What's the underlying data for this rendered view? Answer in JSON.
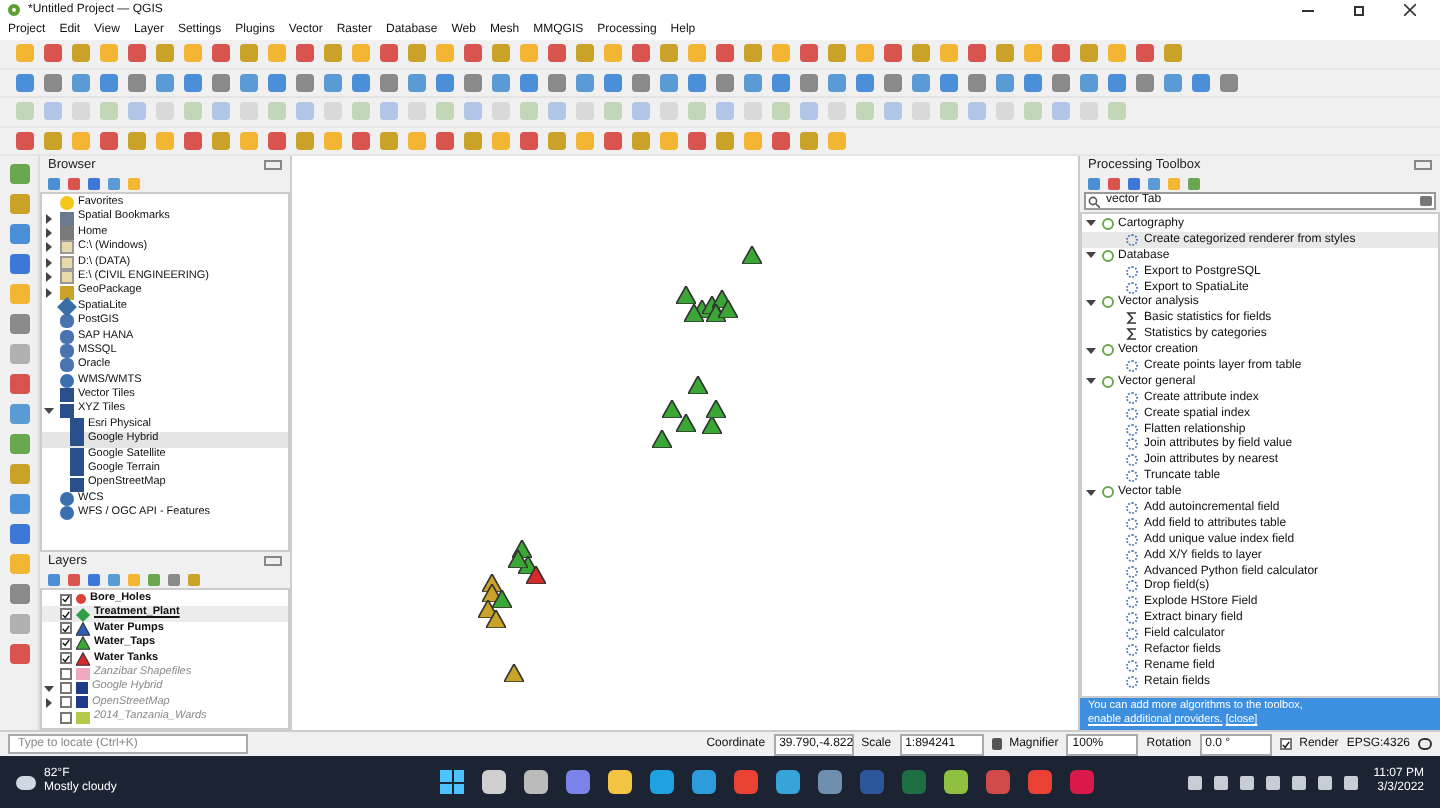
{
  "window": {
    "title": "*Untitled Project — QGIS"
  },
  "menu": [
    "Project",
    "Edit",
    "View",
    "Layer",
    "Settings",
    "Plugins",
    "Vector",
    "Raster",
    "Database",
    "Web",
    "Mesh",
    "MMQGIS",
    "Processing",
    "Help"
  ],
  "browser": {
    "title": "Browser",
    "items": [
      {
        "label": "Favorites"
      },
      {
        "label": "Spatial Bookmarks",
        "expandable": true
      },
      {
        "label": "Home",
        "expandable": true
      },
      {
        "label": "C:\\ (Windows)",
        "expandable": true
      },
      {
        "label": "D:\\ (DATA)",
        "expandable": true
      },
      {
        "label": "E:\\ (CIVIL ENGINEERING)",
        "expandable": true
      },
      {
        "label": "GeoPackage",
        "expandable": true
      },
      {
        "label": "SpatiaLite"
      },
      {
        "label": "PostGIS"
      },
      {
        "label": "SAP HANA"
      },
      {
        "label": "MSSQL"
      },
      {
        "label": "Oracle"
      },
      {
        "label": "WMS/WMTS"
      },
      {
        "label": "Vector Tiles"
      },
      {
        "label": "XYZ Tiles",
        "expandable": true,
        "expanded": true,
        "children": [
          {
            "label": "Esri Physical",
            "selected": false
          },
          {
            "label": "Google Hybrid",
            "selected": true
          },
          {
            "label": "Google Satellite",
            "selected": false
          },
          {
            "label": "Google Terrain",
            "selected": false
          },
          {
            "label": "OpenStreetMap",
            "selected": false
          }
        ]
      },
      {
        "label": "WCS"
      },
      {
        "label": "WFS / OGC API - Features"
      }
    ]
  },
  "layers": {
    "title": "Layers",
    "items": [
      {
        "name": "Bore_Holes",
        "checked": true,
        "selected": false,
        "kind": "dot",
        "color": "#e0403a"
      },
      {
        "name": "Treatment_Plant",
        "checked": true,
        "selected": true,
        "kind": "diamond",
        "color": "#2f9e44"
      },
      {
        "name": "Water Pumps",
        "checked": true,
        "selected": false,
        "kind": "triangle",
        "color": "#2c5fb8"
      },
      {
        "name": "Water_Taps",
        "checked": true,
        "selected": false,
        "kind": "triangle",
        "color": "#3aa635"
      },
      {
        "name": "Water Tanks",
        "checked": true,
        "selected": false,
        "kind": "triangle",
        "color": "#d62a2a"
      },
      {
        "name": "Zanzibar Shapefiles",
        "checked": false,
        "selected": false,
        "kind": "polygon",
        "color": "#f0a8c0"
      },
      {
        "name": "Google Hybrid",
        "checked": false,
        "selected": false,
        "kind": "raster",
        "color": "#1f3a8a",
        "expandable": true,
        "expanded": true
      },
      {
        "name": "OpenStreetMap",
        "checked": false,
        "selected": false,
        "kind": "raster",
        "color": "#1f3a8a",
        "expandable": true,
        "expanded": false
      },
      {
        "name": "2014_Tanzania_Wards",
        "checked": false,
        "selected": false,
        "kind": "polygon",
        "color": "#b5c94a"
      }
    ]
  },
  "toolbox": {
    "title": "Processing Toolbox",
    "search": "vector Tab",
    "groups": [
      {
        "label": "Cartography",
        "expanded": true,
        "children": [
          {
            "label": "Create categorized renderer from styles",
            "kind": "gear",
            "selected": true
          }
        ]
      },
      {
        "label": "Database",
        "expanded": true,
        "children": [
          {
            "label": "Export to PostgreSQL",
            "kind": "gear",
            "selected": false
          },
          {
            "label": "Export to SpatiaLite",
            "kind": "gear",
            "selected": false
          }
        ]
      },
      {
        "label": "Vector analysis",
        "expanded": true,
        "children": [
          {
            "label": "Basic statistics for fields",
            "kind": "sigma",
            "selected": false
          },
          {
            "label": "Statistics by categories",
            "kind": "sigma",
            "selected": false
          }
        ]
      },
      {
        "label": "Vector creation",
        "expanded": true,
        "children": [
          {
            "label": "Create points layer from table",
            "kind": "gear",
            "selected": false
          }
        ]
      },
      {
        "label": "Vector general",
        "expanded": true,
        "children": [
          {
            "label": "Create attribute index",
            "kind": "gear",
            "selected": false
          },
          {
            "label": "Create spatial index",
            "kind": "gear",
            "selected": false
          },
          {
            "label": "Flatten relationship",
            "kind": "gear",
            "selected": false
          },
          {
            "label": "Join attributes by field value",
            "kind": "gear",
            "selected": false
          },
          {
            "label": "Join attributes by nearest",
            "kind": "gear",
            "selected": false
          },
          {
            "label": "Truncate table",
            "kind": "gear",
            "selected": false
          }
        ]
      },
      {
        "label": "Vector table",
        "expanded": true,
        "children": [
          {
            "label": "Add autoincremental field",
            "kind": "gear",
            "selected": false
          },
          {
            "label": "Add field to attributes table",
            "kind": "gear",
            "selected": false
          },
          {
            "label": "Add unique value index field",
            "kind": "gear",
            "selected": false
          },
          {
            "label": "Add X/Y fields to layer",
            "kind": "gear",
            "selected": false
          },
          {
            "label": "Advanced Python field calculator",
            "kind": "gear",
            "selected": false
          },
          {
            "label": "Drop field(s)",
            "kind": "gear",
            "selected": false
          },
          {
            "label": "Explode HStore Field",
            "kind": "gear",
            "selected": false
          },
          {
            "label": "Extract binary field",
            "kind": "gear",
            "selected": false
          },
          {
            "label": "Field calculator",
            "kind": "gear",
            "selected": false
          },
          {
            "label": "Refactor fields",
            "kind": "gear",
            "selected": false
          },
          {
            "label": "Rename field",
            "kind": "gear",
            "selected": false
          },
          {
            "label": "Retain fields",
            "kind": "gear",
            "selected": false
          }
        ]
      }
    ],
    "notice": {
      "text": "You can add more algorithms to the toolbox, ",
      "link": "enable additional providers.",
      "close": "[close]"
    }
  },
  "status_bar": {
    "locate_placeholder": "Type to locate (Ctrl+K)",
    "coordinate_label": "Coordinate",
    "coordinate": "39.790,-4.822",
    "scale_label": "Scale",
    "scale": "1:894241",
    "magnifier_label": "Magnifier",
    "magnifier": "100%",
    "rotation_label": "Rotation",
    "rotation": "0.0 °",
    "render_label": "Render",
    "render_checked": true,
    "crs": "EPSG:4326"
  },
  "taskbar": {
    "temperature": "82°F",
    "weather": "Mostly cloudy",
    "time": "11:07 PM",
    "date": "3/3/2022"
  }
}
